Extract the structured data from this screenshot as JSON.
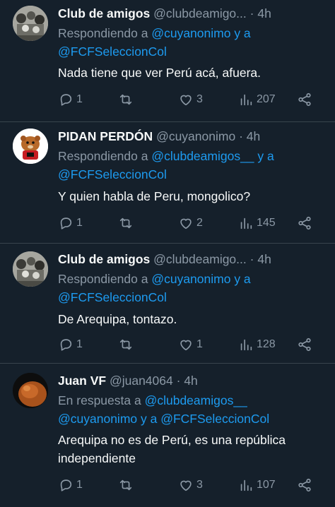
{
  "tweets": [
    {
      "name": "Club de amigos",
      "handle": "@clubdeamigo...",
      "time": "· 4h",
      "reply_prefix": "Respondiendo a ",
      "reply_line1_link": "@cuyanonimo y a",
      "reply_line2_link": "@FCFSeleccionCol",
      "text": "Nada tiene que ver Perú acá, afuera.",
      "replies": "1",
      "retweets": "",
      "likes": "3",
      "views": "207"
    },
    {
      "name": "PIDAN PERDÓN",
      "handle": "@cuyanonimo",
      "time": "· 4h",
      "reply_prefix": "Respondiendo a ",
      "reply_line1_link": "@clubdeamigos__ y a",
      "reply_line2_link": "@FCFSeleccionCol",
      "text": "Y quien habla de Peru, mongolico?",
      "replies": "1",
      "retweets": "",
      "likes": "2",
      "views": "145"
    },
    {
      "name": "Club de amigos",
      "handle": "@clubdeamigo...",
      "time": "· 4h",
      "reply_prefix": "Respondiendo a ",
      "reply_line1_link": "@cuyanonimo y a",
      "reply_line2_link": "@FCFSeleccionCol",
      "text": "De Arequipa, tontazo.",
      "replies": "1",
      "retweets": "",
      "likes": "1",
      "views": "128"
    },
    {
      "name": "Juan VF",
      "handle": "@juan4064",
      "time": "· 4h",
      "reply_prefix": "En respuesta a ",
      "reply_line1_link": "@clubdeamigos__",
      "reply_line2_link": "@cuyanonimo y a @FCFSeleccionCol",
      "text_line1": "Arequipa no es de Perú, es una república",
      "text_line2": "independiente",
      "replies": "1",
      "retweets": "",
      "likes": "3",
      "views": "107"
    }
  ],
  "icons": {
    "reply": "reply-icon",
    "retweet": "retweet-icon",
    "like": "heart-icon",
    "views": "views-icon",
    "share": "share-icon"
  },
  "colors": {
    "background": "#15202b",
    "link": "#1d9bf0",
    "muted": "#8b98a5",
    "text": "#f7f9f9"
  }
}
